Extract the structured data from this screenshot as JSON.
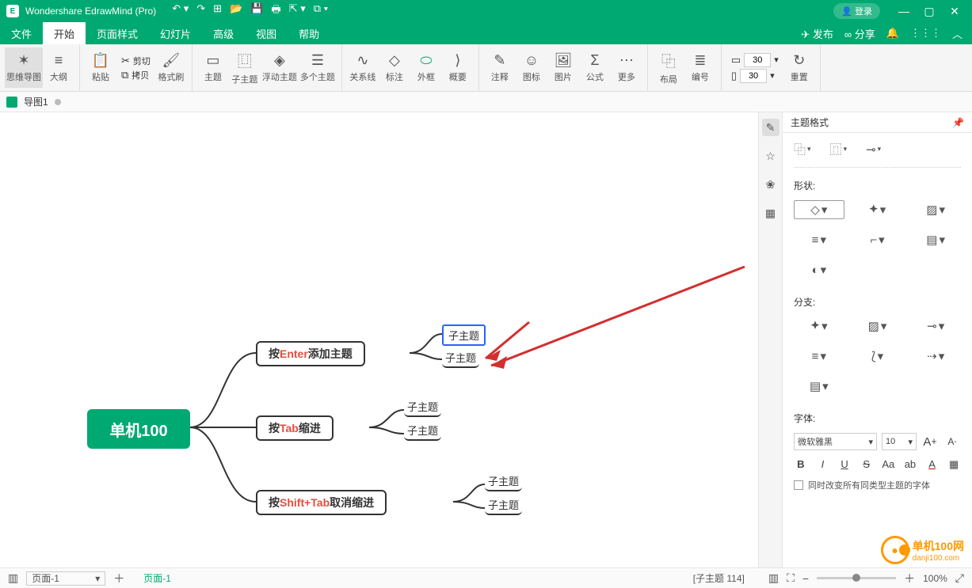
{
  "app": {
    "title": "Wondershare EdrawMind (Pro)",
    "login": "登录"
  },
  "menu": {
    "items": [
      "文件",
      "开始",
      "页面样式",
      "幻灯片",
      "高级",
      "视图",
      "帮助"
    ],
    "activeIndex": 1,
    "publish": "发布",
    "share": "分享"
  },
  "ribbon": {
    "mindmap": "思维导图",
    "outline": "大纲",
    "paste": "粘贴",
    "cut": "剪切",
    "copy": "拷贝",
    "format": "格式刷",
    "topic": "主题",
    "subtopic": "子主题",
    "floating": "浮动主题",
    "multi": "多个主题",
    "relation": "关系线",
    "callout": "标注",
    "boundary": "外框",
    "summary": "概要",
    "comment": "注释",
    "icon": "图标",
    "image": "图片",
    "formula": "公式",
    "more": "更多",
    "layout": "布局",
    "numbering": "编号",
    "spacing1": 30,
    "spacing2": 30,
    "reset": "重置"
  },
  "doctab": {
    "name": "导图1"
  },
  "mindmap": {
    "root": "单机100",
    "branches": [
      {
        "label_pre": "按 ",
        "kw": "Enter",
        "label_post": " 添加主题",
        "children": [
          "子主题",
          "子主题"
        ],
        "selectedChild": 0
      },
      {
        "label_pre": "按 ",
        "kw": "Tab",
        "label_post": " 缩进",
        "children": [
          "子主题",
          "子主题"
        ]
      },
      {
        "label_pre": "按 ",
        "kw": "Shift+Tab",
        "label_post": " 取消缩进",
        "children": [
          "子主题",
          "子主题"
        ]
      }
    ]
  },
  "panel": {
    "title": "主题格式",
    "shape_label": "形状:",
    "branch_label": "分支:",
    "font_label": "字体:",
    "font_name": "微软雅黑",
    "font_size": "10",
    "same_type_check": "同时改变所有同类型主题的字体"
  },
  "status": {
    "page_sel": "页面-1",
    "page_tab": "页面-1",
    "selection": "[子主题 114]",
    "zoom": "100%"
  },
  "watermark": {
    "text": "单机100网",
    "url": "danji100.com"
  }
}
